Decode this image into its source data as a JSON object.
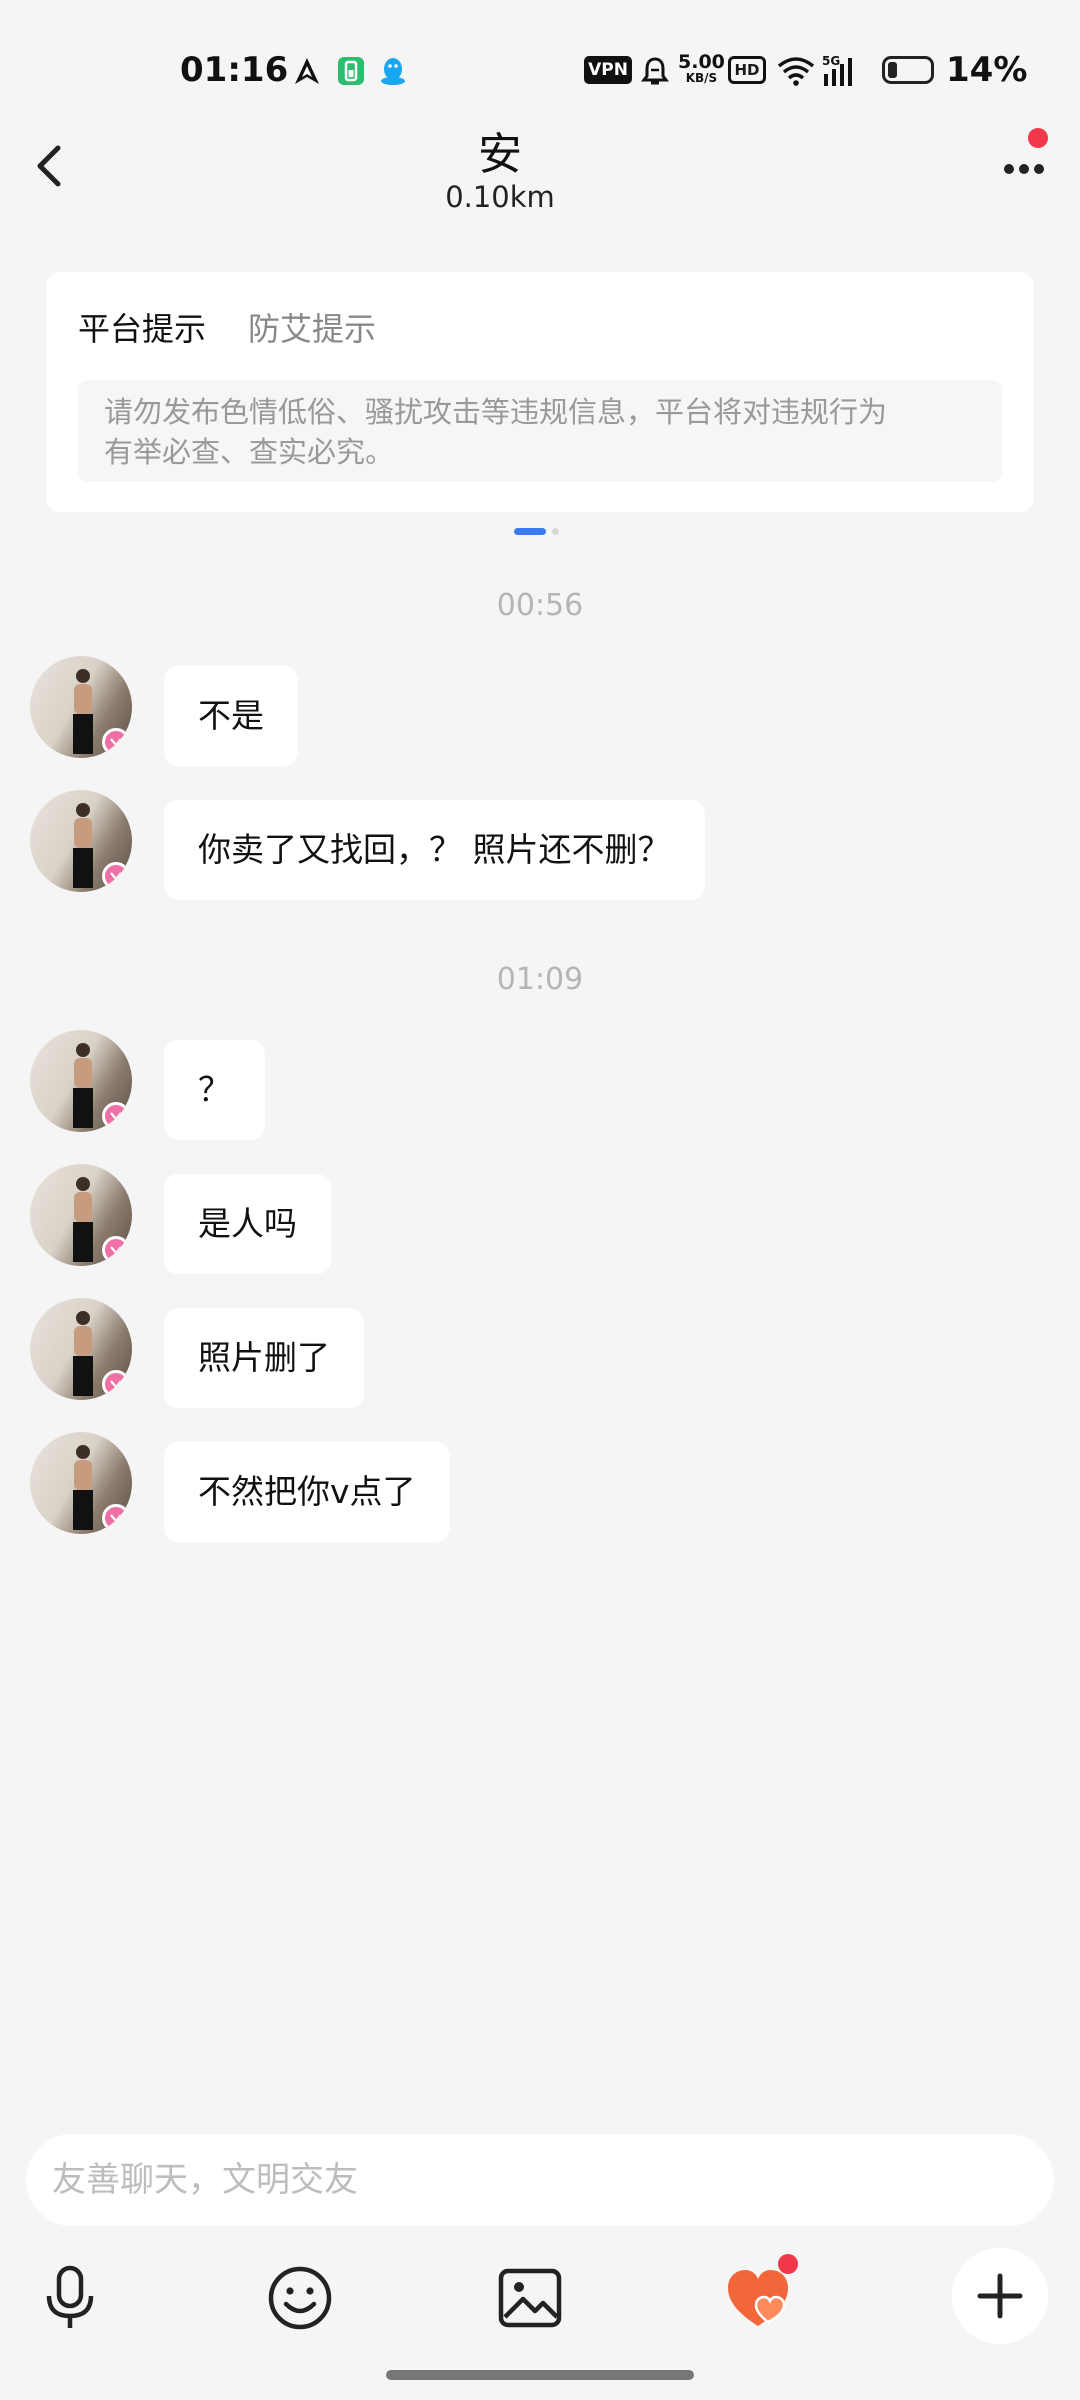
{
  "status_bar": {
    "time": "01:16",
    "vpn_label": "VPN",
    "net_speed_value": "5.00",
    "net_speed_unit": "KB/S",
    "hd_label": "HD",
    "signal_label": "5G",
    "battery_percent": "14%",
    "battery_level": 0.14,
    "left_icons": [
      "navigation-arrow-icon",
      "battery-saver-icon",
      "qq-penguin-icon"
    ],
    "right_icons": [
      "vpn-icon",
      "alarm-icon",
      "hd-icon",
      "wifi-icon",
      "signal-5g-icon",
      "battery-icon"
    ]
  },
  "header": {
    "title": "安",
    "distance": "0.10km",
    "back_icon": "chevron-left-icon",
    "more_icon": "more-dots-icon",
    "has_notification_dot": true
  },
  "notice": {
    "tabs": [
      "平台提示",
      "防艾提示"
    ],
    "active_tab": 0,
    "text_line1": "请勿发布色情低俗、骚扰攻击等违规信息，平台将对违规行为",
    "text_line2": "有举必查、查实必究。",
    "page_count": 2,
    "active_page": 0
  },
  "chat": {
    "groups": [
      {
        "timestamp": "00:56",
        "messages": [
          {
            "text": "不是"
          },
          {
            "text": "你卖了又找回，？ 照片还不删？"
          }
        ]
      },
      {
        "timestamp": "01:09",
        "messages": [
          {
            "text": "？"
          },
          {
            "text": "是人吗"
          },
          {
            "text": "照片删了"
          },
          {
            "text": "不然把你v点了"
          }
        ]
      }
    ]
  },
  "input": {
    "placeholder": "友善聊天，文明交友",
    "value": ""
  },
  "toolbar": {
    "items": [
      "microphone-icon",
      "emoji-icon",
      "image-icon",
      "heart-gift-icon",
      "plus-icon"
    ],
    "gift_has_badge": true
  },
  "colors": {
    "background": "#f5f5f5",
    "accent_blue": "#3a7bf0",
    "badge_red": "#f0384a",
    "vip_pink": "#f06fa4",
    "heart_orange": "#f2673a"
  }
}
